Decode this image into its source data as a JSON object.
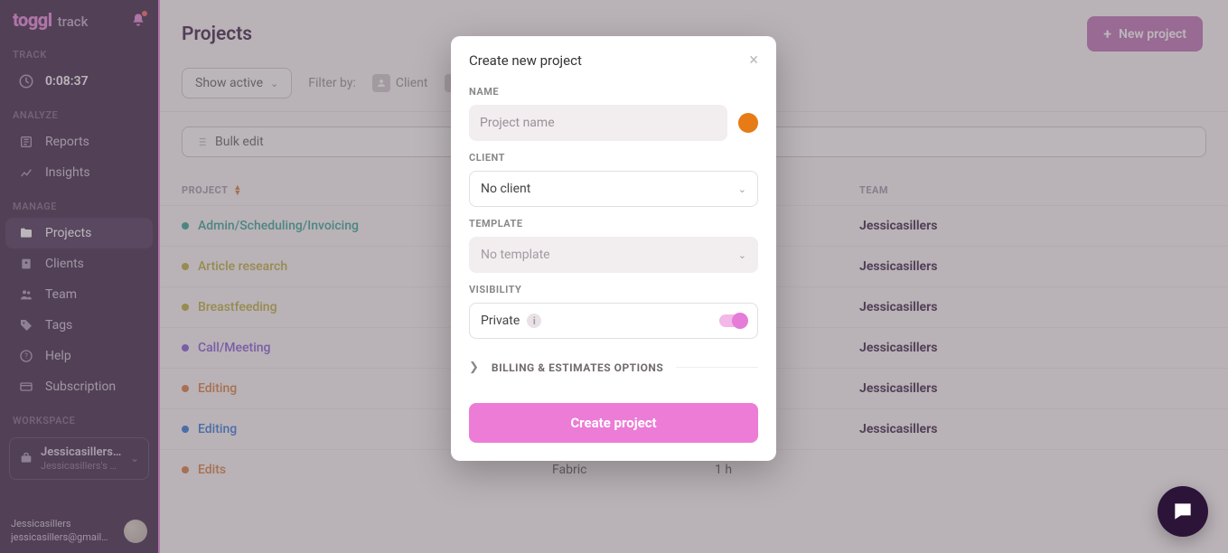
{
  "logo": {
    "main": "toggl",
    "sub": "track"
  },
  "sidebar": {
    "sections": {
      "track": "TRACK",
      "analyze": "ANALYZE",
      "manage": "MANAGE",
      "workspace": "WORKSPACE"
    },
    "timer": "0:08:37",
    "reports": "Reports",
    "insights": "Insights",
    "projects": "Projects",
    "clients": "Clients",
    "team": "Team",
    "tags": "Tags",
    "help": "Help",
    "subscription": "Subscription",
    "workspace_name": "Jessicasillers'…",
    "workspace_sub": "Jessicasillers's w…",
    "user_name": "Jessicasillers",
    "user_email": "jessicasillers@gmail…"
  },
  "page": {
    "title": "Projects",
    "new_project": "New project",
    "show_active": "Show active",
    "filter_by": "Filter by:",
    "filter_client": "Client",
    "bulk_edit": "Bulk edit",
    "col_project": "PROJECT",
    "col_team": "TEAM"
  },
  "projects": [
    {
      "name": "Admin/Scheduling/Invoicing",
      "color": "#1f9e8e",
      "client": "",
      "time": "",
      "team": "Jessicasillers"
    },
    {
      "name": "Article research",
      "color": "#b7a92b",
      "client": "",
      "time": "",
      "team": "Jessicasillers"
    },
    {
      "name": "Breastfeeding",
      "color": "#b7a92b",
      "client": "",
      "time": "",
      "team": "Jessicasillers"
    },
    {
      "name": "Call/Meeting",
      "color": "#7b4dd6",
      "client": "",
      "time": "",
      "team": "Jessicasillers"
    },
    {
      "name": "Editing",
      "color": "#d6752c",
      "client": "",
      "time": "",
      "team": "Jessicasillers"
    },
    {
      "name": "Editing",
      "color": "#1f6fd6",
      "client": "",
      "time": "",
      "team": "Jessicasillers"
    },
    {
      "name": "Edits",
      "color": "#d6752c",
      "client": "Fabric",
      "time": "1 h",
      "team": ""
    }
  ],
  "modal": {
    "title": "Create new project",
    "name_label": "NAME",
    "name_placeholder": "Project name",
    "client_label": "CLIENT",
    "client_value": "No client",
    "template_label": "TEMPLATE",
    "template_value": "No template",
    "visibility_label": "VISIBILITY",
    "visibility_value": "Private",
    "billing_label": "BILLING & ESTIMATES OPTIONS",
    "create": "Create project",
    "color": "#e77b16"
  }
}
